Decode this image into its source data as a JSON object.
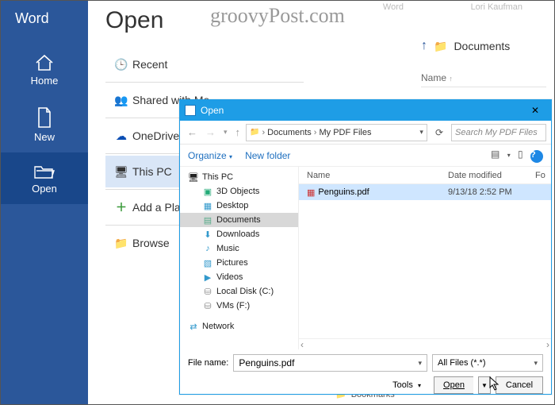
{
  "watermark": "groovyPost.com",
  "topHints": {
    "app": "Word",
    "user": "Lori Kaufman"
  },
  "sidebar": {
    "app": "Word",
    "items": [
      {
        "label": "Home"
      },
      {
        "label": "New"
      },
      {
        "label": "Open"
      }
    ]
  },
  "page": {
    "title": "Open",
    "locations": {
      "recent": "Recent",
      "shared": "Shared with Me",
      "onedrive": "OneDrive",
      "thispc": "This PC",
      "addplace": "Add a Place",
      "browse": "Browse"
    },
    "right": {
      "path_folder": "Documents",
      "name_header": "Name"
    }
  },
  "dialog": {
    "title": "Open",
    "breadcrumb": {
      "seg1": "Documents",
      "seg2": "My PDF Files"
    },
    "search_placeholder": "Search My PDF Files",
    "toolbar": {
      "organize": "Organize",
      "newfolder": "New folder"
    },
    "tree": {
      "thispc": "This PC",
      "threed": "3D Objects",
      "desktop": "Desktop",
      "documents": "Documents",
      "downloads": "Downloads",
      "music": "Music",
      "pictures": "Pictures",
      "videos": "Videos",
      "localc": "Local Disk (C:)",
      "vmsf": "VMs (F:)",
      "network": "Network"
    },
    "headers": {
      "name": "Name",
      "date": "Date modified",
      "last": "Fo"
    },
    "file": {
      "name": "Penguins.pdf",
      "date": "9/13/18 2:52 PM"
    },
    "footer": {
      "filename_label": "File name:",
      "filename_value": "Penguins.pdf",
      "filter": "All Files (*.*)",
      "tools": "Tools",
      "open": "Open",
      "cancel": "Cancel"
    }
  },
  "peek": "Bookmarks"
}
